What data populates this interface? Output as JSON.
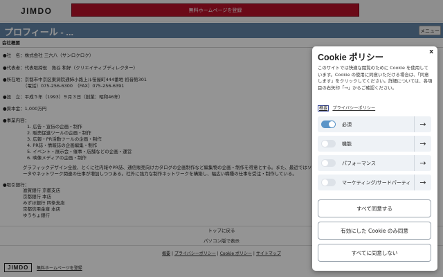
{
  "header": {
    "logo": "JIMDO",
    "signup_label": "無料ホームページを登録"
  },
  "titlebar": {
    "title": "プロフィール - ...",
    "menu_label": "メニュー"
  },
  "profile": {
    "section_head": "会社概要",
    "company": "●社　名：株式会社 三六八（サンロクロク）",
    "representative": "●代表者：代表取締役　角谷 和好（クリエイティブディレクター）",
    "address_line1": "●所在地：京都市中京区東洞院通姉小路上ル笹屋町444番地 初音館301",
    "address_line2": "（電話）075-256-6300　（FAX）075-256-6391",
    "founded": "●設　立：平成５年（1993）９月３日（創業：昭和46年）",
    "capital": "●資本金：1,000万円",
    "business_head": "●事業内容：",
    "business_items": [
      "1. 広告・宣伝の企画・制作",
      "2. 販売促進ツールの企画・制作",
      "3. 広報・PR活動ツールの企画・制作",
      "4. PR誌・情報誌の企画編集・制作",
      "5. イベント・展示会・催事・店舗などの企画・運営",
      "6. 映像メディアの企画・制作"
    ],
    "business_desc1": "グラフィックデザイン全般、とくに社内報やPR誌、通信販売向けカタログの企画制作など編集物の企画・制作を得意とする。また、最近ではソフトウェアの",
    "business_desc2": "ータやネットワーク関連の仕事が増加しつつある。社外に強力な制作ネットワークを構築し、幅広い職種の仕事を受注・制作している。",
    "banks_head": "●取引銀行：",
    "banks": [
      "滋賀銀行 京都支店",
      "京都銀行 本店",
      "みずほ銀行 四条支店",
      "京都信用金庫 本店",
      "ゆうちょ銀行"
    ]
  },
  "footer": {
    "back_to_top": "トップに戻る",
    "pc_view": "パソコン版で表示",
    "link_overview": "概要",
    "link_privacy": "プライバシーポリシー",
    "link_cookie": "Cookie ポリシー",
    "link_sitemap": "サイトマップ",
    "sep": " | ",
    "logo": "JIMDO",
    "signup": "無料ホームページを登録"
  },
  "cookie": {
    "title": "Cookie ポリシー",
    "close": "x",
    "description": "このサイトでは快適な閲覧のために Cookie を使用しています。Cookie の使用に同意いただける場合は、「同意します」をクリックしてください。詳細については、各項目の右矢印「→」からご確認ください。",
    "link_overview": "概要",
    "link_privacy": "プライバシーポリシー",
    "categories": [
      {
        "label": "必須",
        "enabled": true
      },
      {
        "label": "機能",
        "enabled": false
      },
      {
        "label": "パフォーマンス",
        "enabled": false
      },
      {
        "label": "マーケティング/サードパーティ",
        "enabled": false
      }
    ],
    "arrow": "→",
    "accept_all": "すべて同意する",
    "accept_selected": "有効にした Cookie のみ同意",
    "reject_all": "すべてに同意しない"
  },
  "colors": {
    "signup_bg": "#b8122a",
    "titlebar_bg": "#6286a8",
    "toggle_on": "#5b95c8"
  }
}
